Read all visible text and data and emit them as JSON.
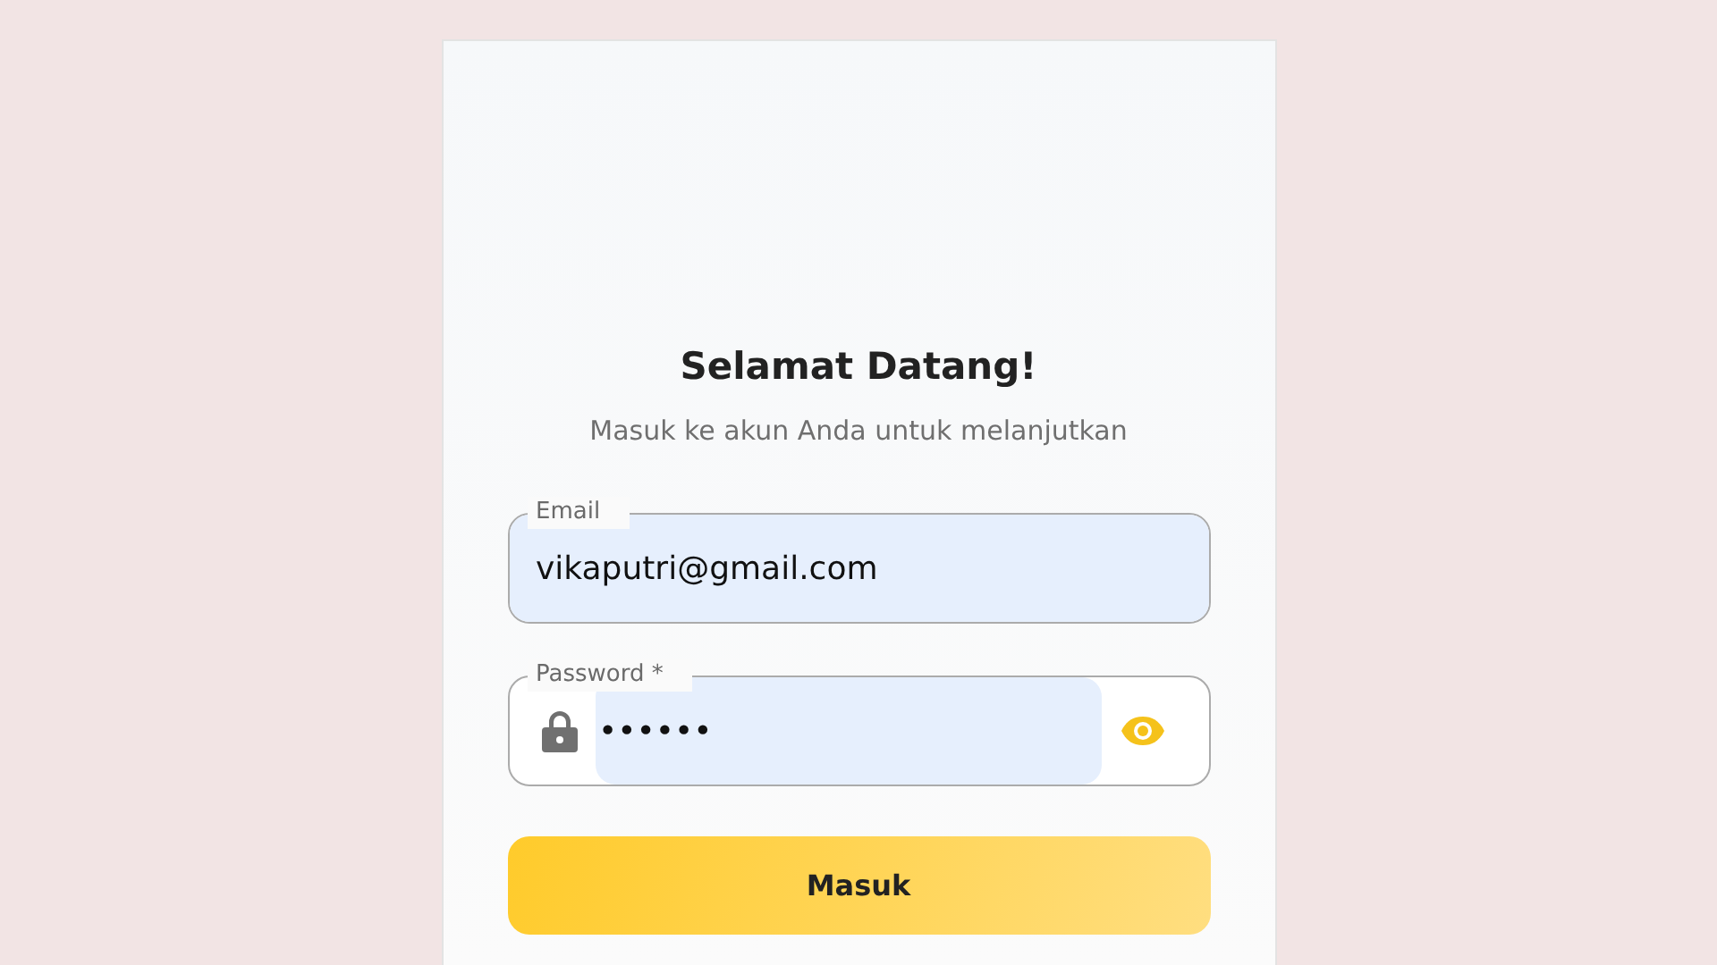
{
  "title": "Selamat Datang!",
  "subtitle": "Masuk ke akun Anda untuk melanjutkan",
  "fields": [
    {
      "kind": "email",
      "label": "Email",
      "value": "vikaputri@gmail.com",
      "autofilled": true
    },
    {
      "kind": "password",
      "label": "Password *",
      "value": "••••••",
      "autofilled": true
    }
  ],
  "submit": "Masuk"
}
